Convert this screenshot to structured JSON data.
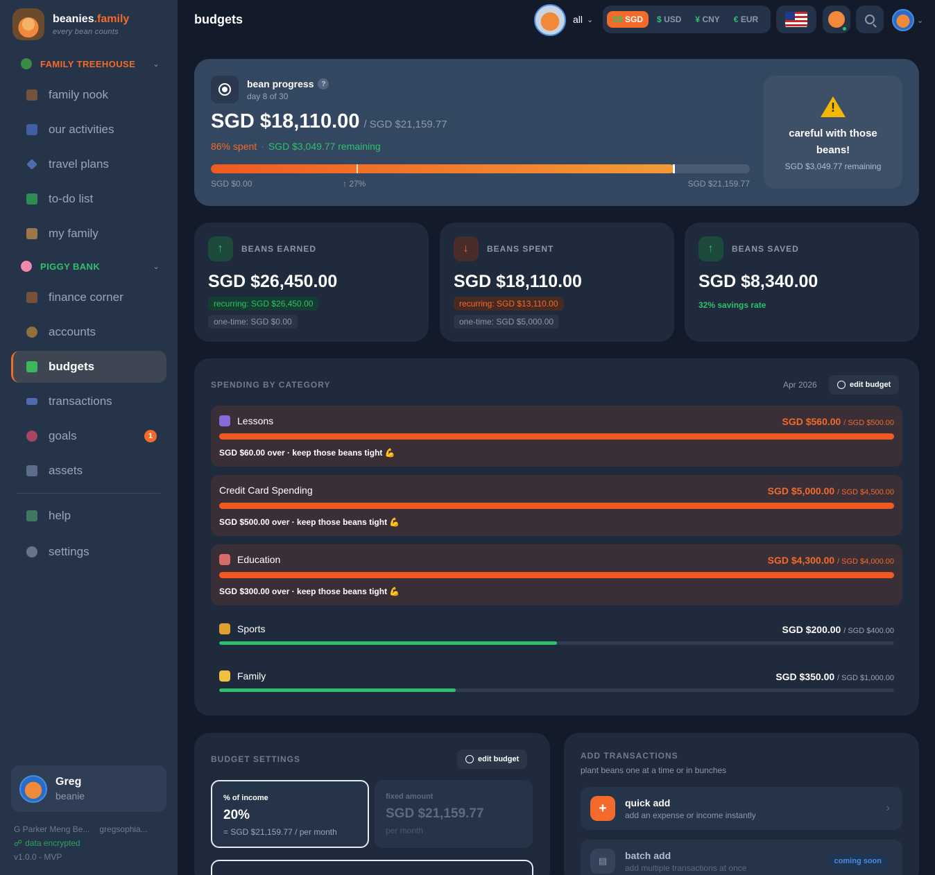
{
  "brand": {
    "name": "beanies",
    "name_accent": ".family",
    "tagline": "every bean counts"
  },
  "sidebar": {
    "family_section": "FAMILY TREEHOUSE",
    "piggy_section": "PIGGY BANK",
    "items": [
      {
        "label": "family nook"
      },
      {
        "label": "our activities"
      },
      {
        "label": "travel plans"
      },
      {
        "label": "to-do list"
      },
      {
        "label": "my family"
      },
      {
        "label": "finance corner"
      },
      {
        "label": "accounts"
      },
      {
        "label": "budgets"
      },
      {
        "label": "transactions"
      },
      {
        "label": "goals",
        "badge": "1"
      },
      {
        "label": "assets"
      },
      {
        "label": "help"
      },
      {
        "label": "settings"
      }
    ],
    "user": {
      "name": "Greg",
      "role": "beanie"
    },
    "footer": {
      "family": "G Parker Meng Be...",
      "email": "gregsophia...",
      "encrypted": "data encrypted",
      "version": "v1.0.0 - MVP"
    }
  },
  "header": {
    "title": "budgets",
    "scope": "all",
    "currencies": [
      {
        "symbol": "S$",
        "code": "SGD"
      },
      {
        "symbol": "$",
        "code": "USD"
      },
      {
        "symbol": "¥",
        "code": "CNY"
      },
      {
        "symbol": "€",
        "code": "EUR"
      }
    ]
  },
  "progress": {
    "title": "bean progress",
    "help": "?",
    "day": "day 8 of 30",
    "spent": "SGD $18,110.00",
    "total": "/ SGD $21,159.77",
    "pct_text": "86% spent",
    "sep": "·",
    "remaining": "SGD $3,049.77 remaining",
    "fill_fraction": 0.86,
    "day_fraction": 0.27,
    "scale_min": "SGD $0.00",
    "scale_mid": "↑ 27%",
    "scale_max": "SGD $21,159.77",
    "warning_title": "careful with those beans!",
    "warning_sub": "SGD $3,049.77 remaining"
  },
  "stats": {
    "earned": {
      "label": "BEANS EARNED",
      "value": "SGD $26,450.00",
      "recurring": "recurring: SGD $26,450.00",
      "onetime": "one-time: SGD $0.00"
    },
    "spent": {
      "label": "BEANS SPENT",
      "value": "SGD $18,110.00",
      "recurring": "recurring: SGD $13,110.00",
      "onetime": "one-time: SGD $5,000.00"
    },
    "saved": {
      "label": "BEANS SAVED",
      "value": "SGD $8,340.00",
      "note": "32% savings rate"
    }
  },
  "spending": {
    "title": "SPENDING BY CATEGORY",
    "period": "Apr 2026",
    "edit": "edit budget",
    "categories": [
      {
        "name": "Lessons",
        "spent": "SGD $560.00",
        "limit": "/ SGD $500.00",
        "note": "SGD $60.00 over · keep those beans tight 💪",
        "fraction": 1.0,
        "over": true,
        "icon_color": "#8a6ad8"
      },
      {
        "name": "Credit Card Spending",
        "spent": "SGD $5,000.00",
        "limit": "/ SGD $4,500.00",
        "note": "SGD $500.00 over · keep those beans tight 💪",
        "fraction": 1.0,
        "over": true,
        "icon_color": ""
      },
      {
        "name": "Education",
        "spent": "SGD $4,300.00",
        "limit": "/ SGD $4,000.00",
        "note": "SGD $300.00 over · keep those beans tight 💪",
        "fraction": 1.0,
        "over": true,
        "icon_color": "#d86a6a"
      },
      {
        "name": "Sports",
        "spent": "SGD $200.00",
        "limit": "/ SGD $400.00",
        "fraction": 0.5,
        "over": false,
        "icon_color": "#e0a030"
      },
      {
        "name": "Family",
        "spent": "SGD $350.00",
        "limit": "/ SGD $1,000.00",
        "fraction": 0.35,
        "over": false,
        "icon_color": "#f0c040"
      }
    ]
  },
  "budget_settings": {
    "title": "BUDGET SETTINGS",
    "edit": "edit budget",
    "pct_option": {
      "title": "% of income",
      "value": "20%",
      "sub": "= SGD $21,159.77 / per month"
    },
    "fixed_option": {
      "title": "fixed amount",
      "value": "SGD $21,159.77",
      "sub": "per month"
    }
  },
  "add_transactions": {
    "title": "ADD TRANSACTIONS",
    "subtitle": "plant beans one at a time or in bunches",
    "quick": {
      "title": "quick add",
      "sub": "add an expense or income instantly"
    },
    "batch": {
      "title": "batch add",
      "sub": "add multiple transactions at once",
      "badge": "coming soon"
    }
  }
}
